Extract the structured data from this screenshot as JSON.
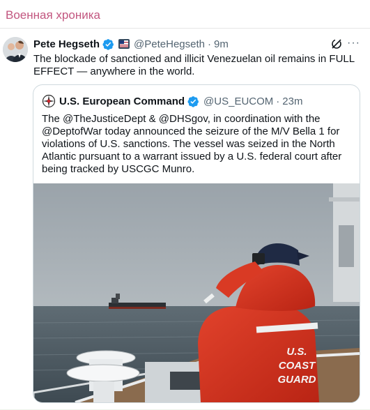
{
  "channel": {
    "name": "Военная хроника"
  },
  "tweet": {
    "author_name": "Pete Hegseth",
    "handle": "@PeteHegseth",
    "time": "9m",
    "separator": "·",
    "more": "···",
    "text": "The blockade of sanctioned and illicit Venezuelan oil remains in FULL EFFECT — anywhere in the world."
  },
  "quote": {
    "author_name": "U.S. European Command",
    "handle": "@US_EUCOM",
    "time": "23m",
    "separator": "·",
    "text": "The @TheJusticeDept & @DHSgov, in coordination with the @DeptofWar today announced the seizure of the M/V Bella 1 for violations of U.S. sanctions. The vessel was seized in the North Atlantic pursuant to a warrant issued by a U.S. federal court after being tracked by USCGC Munro.",
    "jacket_text": [
      "U.S.",
      "COAST",
      "GUARD"
    ]
  },
  "colors": {
    "channel_name": "#c2567f",
    "verified": "#1d9bf0",
    "muted_text": "#536471",
    "jacket": "#d6321d"
  },
  "icons": {
    "verified": "verified-badge-icon",
    "flag": "us-flag-badge-icon",
    "grok": "grok-icon",
    "more": "more-options-icon",
    "eucom": "eucom-emblem-icon"
  }
}
